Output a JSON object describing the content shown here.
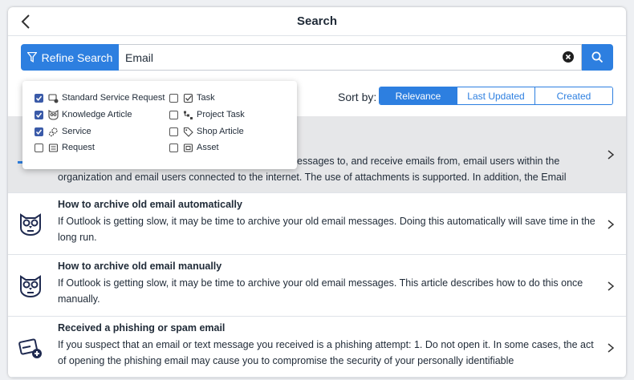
{
  "header": {
    "title": "Search"
  },
  "search": {
    "refine_label": "Refine Search",
    "query": "Email"
  },
  "sort": {
    "label": "Sort by:",
    "options": [
      "Relevance",
      "Last Updated",
      "Created"
    ],
    "selected": "Relevance"
  },
  "filters": [
    {
      "label": "Standard Service Request",
      "checked": true,
      "icon": "service-request-icon"
    },
    {
      "label": "Knowledge Article",
      "checked": true,
      "icon": "owl-icon"
    },
    {
      "label": "Service",
      "checked": true,
      "icon": "gears-icon"
    },
    {
      "label": "Request",
      "checked": false,
      "icon": "request-icon"
    },
    {
      "label": "Task",
      "checked": false,
      "icon": "task-icon"
    },
    {
      "label": "Project Task",
      "checked": false,
      "icon": "project-task-icon"
    },
    {
      "label": "Shop Article",
      "checked": false,
      "icon": "tag-icon"
    },
    {
      "label": "Asset",
      "checked": false,
      "icon": "asset-icon"
    }
  ],
  "results": [
    {
      "title": "",
      "description": "The Email service provides the ability to send email messages to, and receive emails from, email users within the organization and email users connected to the internet. The use of attachments is supported. In addition, the Email",
      "icon": "service-icon"
    },
    {
      "title": "How to archive old email automatically",
      "description": "If Outlook is getting slow, it may be time to archive your old email messages. Doing this automatically will save time in the long run.",
      "icon": "owl-icon"
    },
    {
      "title": "How to archive old email manually",
      "description": "If Outlook is getting slow, it may be time to archive your old email messages. This article describes how to do this once manually.",
      "icon": "owl-icon"
    },
    {
      "title": "Received a phishing or spam email",
      "description": "If you suspect that an email or text message you received is a phishing attempt: 1. Do not open it. In some cases, the act of opening the phishing email may cause you to compromise the security of your personally identifiable",
      "icon": "service-request-icon"
    }
  ],
  "colors": {
    "accent": "#2d7fe0",
    "highlight_row": "#e6e7e9"
  }
}
